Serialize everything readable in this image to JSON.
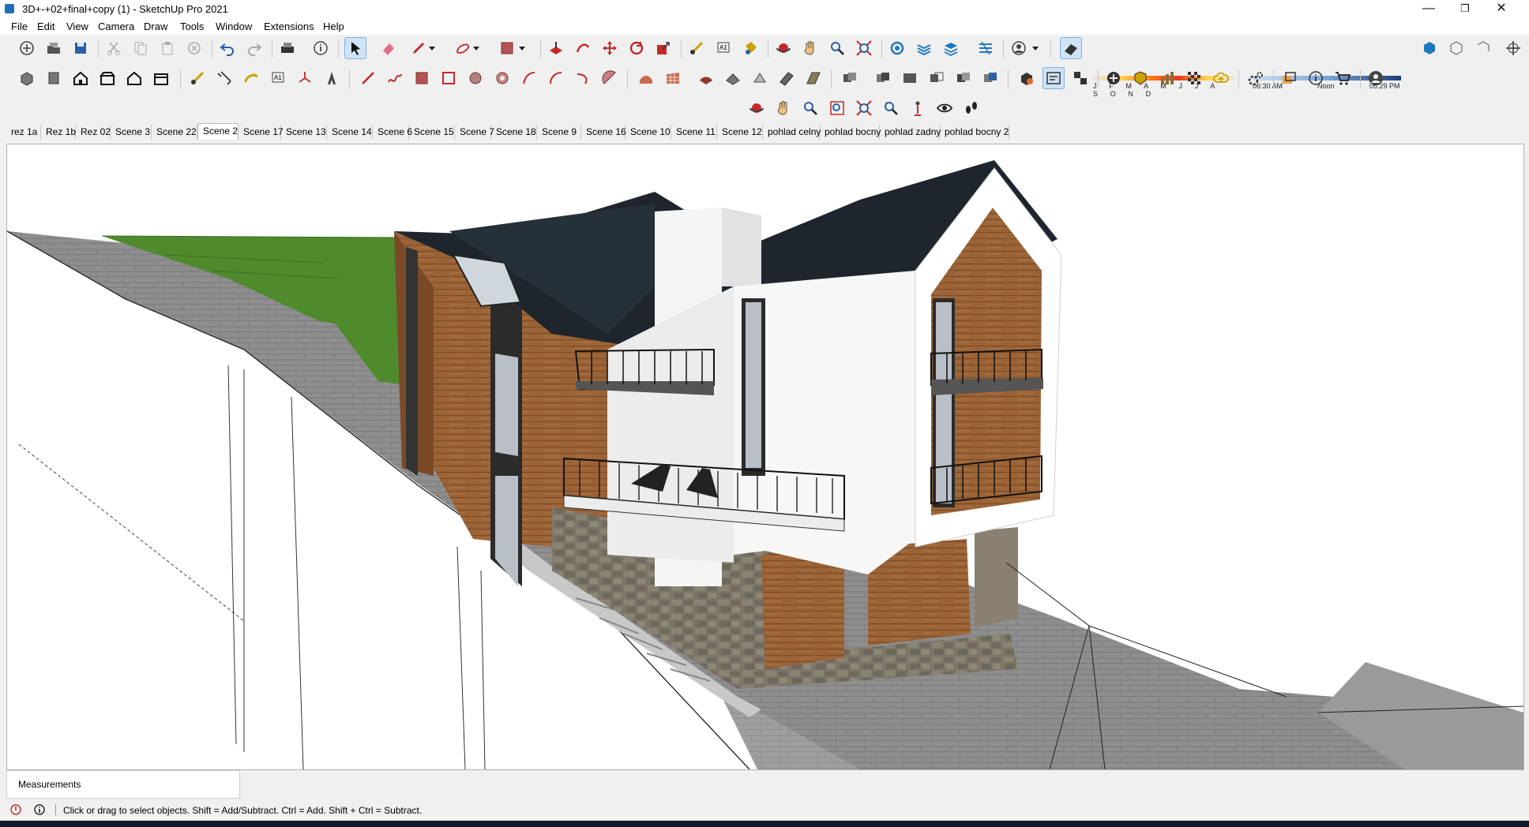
{
  "window": {
    "title": "3D+-+02+final+copy (1) - SketchUp Pro 2021",
    "minimize": "—",
    "restore": "❐",
    "close": "✕"
  },
  "menu": [
    "File",
    "Edit",
    "View",
    "Camera",
    "Draw",
    "Tools",
    "Window",
    "Extensions",
    "Help"
  ],
  "shadow": {
    "months": "J F M A M J J A S O N D",
    "time_start": "06:30 AM",
    "time_mid": "Noon",
    "time_end": "05:29 PM"
  },
  "scenes": [
    "rez 1a",
    "Rez 1b",
    "Rez 02",
    "Scene 3",
    "Scene 22",
    "Scene 2",
    "Scene 17",
    "Scene 13",
    "Scene 14",
    "Scene 6",
    "Scene 15",
    "Scene 7",
    "Scene 18",
    "Scene 9",
    "Scene 16",
    "Scene 10",
    "Scene 11",
    "Scene 12",
    "pohlad celny",
    "pohlad bocny",
    "pohlad zadny",
    "pohlad bocny 2"
  ],
  "active_scene": "Scene 2",
  "measurements": {
    "label": "Measurements"
  },
  "status": {
    "message": "Click or drag to select objects. Shift = Add/Subtract. Ctrl = Add. Shift + Ctrl = Subtract."
  },
  "colors": {
    "accent": "#1e6fb8",
    "roof": "#1f252c",
    "wood": "#9b6336",
    "stone": "#7d7668",
    "grass": "#4f8a2c",
    "pavement": "#8c8c8c"
  },
  "toolbar_icons": {
    "row1": [
      "new-icon",
      "open-icon",
      "save-icon",
      "cut-icon",
      "copy-icon",
      "paste-icon",
      "erase-icon",
      "undo-icon",
      "redo-icon",
      "print-icon",
      "model-info-icon",
      "select-icon",
      "eraser-icon",
      "pencil-icon",
      "freehand-icon",
      "shape-icon",
      "rectangle-icon",
      "push-pull-icon",
      "follow-me-icon",
      "move-icon",
      "rotate-icon",
      "scale-icon",
      "tape-icon",
      "text-icon",
      "paint-icon",
      "orbit-icon",
      "pan-icon",
      "zoom-icon",
      "zoom-extents-icon",
      "styles-icon",
      "section-icon",
      "layers-icon",
      "match-photo-icon",
      "user-icon",
      "shadow-toggle-icon"
    ],
    "row2": [
      "iso-view-icon",
      "top-view-icon",
      "front-view-icon",
      "right-view-icon",
      "back-view-icon",
      "left-view-icon",
      "tape-measure-icon",
      "dimension-icon",
      "protractor-icon",
      "text-tool-icon",
      "axes-icon",
      "3d-text-icon",
      "line-icon",
      "freehand-line-icon",
      "rectangle-tool-icon",
      "rotated-rectangle-icon",
      "circle-icon",
      "polygon-icon",
      "arc-icon",
      "2pt-arc-icon",
      "3pt-arc-icon",
      "pie-icon",
      "sandbox-contours-icon",
      "sandbox-grid-icon",
      "smoove-icon",
      "stamp-icon",
      "drape-icon",
      "add-detail-icon",
      "flip-edge-icon",
      "outer-shell-icon",
      "intersect-icon",
      "union-icon",
      "subtract-icon",
      "trim-icon",
      "split-icon",
      "warehouse-icon",
      "extension-manager-icon",
      "component-icon",
      "geo-location-icon",
      "photo-texture-icon",
      "preview-icon",
      "cloud-icon",
      "settings-icon",
      "send-to-layout-icon",
      "info-icon",
      "cart-icon",
      "account-icon"
    ],
    "row3": [
      "orbit-view-icon",
      "pan-view-icon",
      "zoom-view-icon",
      "zoom-window-icon",
      "zoom-extents-view-icon",
      "previous-view-icon",
      "position-camera-icon",
      "look-around-icon",
      "walk-icon"
    ]
  }
}
